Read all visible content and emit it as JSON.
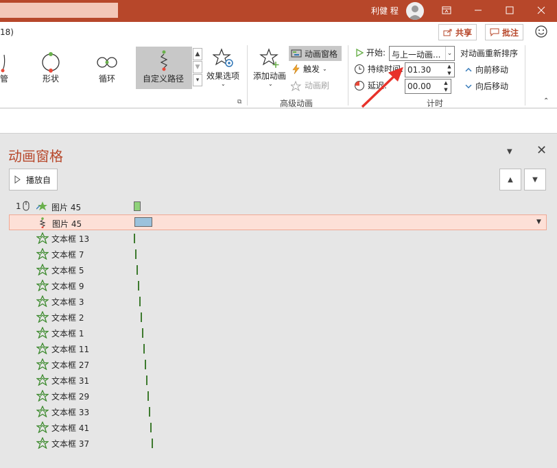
{
  "titlebar": {
    "user_name": "利健 程",
    "bg_color": "#b7472a"
  },
  "ribbon_top": {
    "doc_name": "18)",
    "share_label": "共享",
    "comment_label": "批注"
  },
  "gallery": {
    "items": [
      {
        "label": "管",
        "icon": "partial-effect-icon"
      },
      {
        "label": "形状",
        "icon": "shape-circle-icon"
      },
      {
        "label": "循环",
        "icon": "loop-icon"
      },
      {
        "label": "自定义路径",
        "icon": "custom-path-icon",
        "selected": true
      }
    ],
    "effect_options_label": "效果选项"
  },
  "advanced": {
    "add_animation_label": "添加动画",
    "animation_pane_label": "动画窗格",
    "trigger_label": "触发",
    "painter_label": "动画刷",
    "group_label": "高级动画"
  },
  "timing": {
    "start_label": "开始:",
    "start_value": "与上一动画...",
    "duration_label": "持续时间:",
    "duration_value": "01.30",
    "delay_label": "延迟:",
    "delay_value": "00.00",
    "reorder_label": "对动画重新排序",
    "move_earlier_label": "向前移动",
    "move_later_label": "向后移动",
    "group_label": "计时"
  },
  "pane": {
    "title": "动画窗格",
    "play_label": "播放自",
    "rows": [
      {
        "num": "1",
        "name": "图片 45",
        "type": "entrance",
        "bar_color": "#8fd27a",
        "bar_kind": "box",
        "trigger": "on-click"
      },
      {
        "num": "",
        "name": "图片 45",
        "type": "motion-path",
        "bar_color": "#9cc2dc",
        "bar_kind": "box",
        "selected": true
      },
      {
        "num": "",
        "name": "文本框 13",
        "type": "emphasis"
      },
      {
        "num": "",
        "name": "文本框 7",
        "type": "emphasis"
      },
      {
        "num": "",
        "name": "文本框 5",
        "type": "emphasis"
      },
      {
        "num": "",
        "name": "文本框 9",
        "type": "emphasis"
      },
      {
        "num": "",
        "name": "文本框 3",
        "type": "emphasis"
      },
      {
        "num": "",
        "name": "文本框 2",
        "type": "emphasis"
      },
      {
        "num": "",
        "name": "文本框 1",
        "type": "emphasis"
      },
      {
        "num": "",
        "name": "文本框 11",
        "type": "emphasis"
      },
      {
        "num": "",
        "name": "文本框 27",
        "type": "emphasis"
      },
      {
        "num": "",
        "name": "文本框 31",
        "type": "emphasis"
      },
      {
        "num": "",
        "name": "文本框 29",
        "type": "emphasis"
      },
      {
        "num": "",
        "name": "文本框 33",
        "type": "emphasis"
      },
      {
        "num": "",
        "name": "文本框 41",
        "type": "emphasis"
      },
      {
        "num": "",
        "name": "文本框 37",
        "type": "emphasis"
      }
    ]
  },
  "colors": {
    "accent": "#b7472a",
    "selected_row": "#fde0d7",
    "emphasis_bar": "#3d7a2e",
    "annotation_arrow": "#e8322a"
  }
}
